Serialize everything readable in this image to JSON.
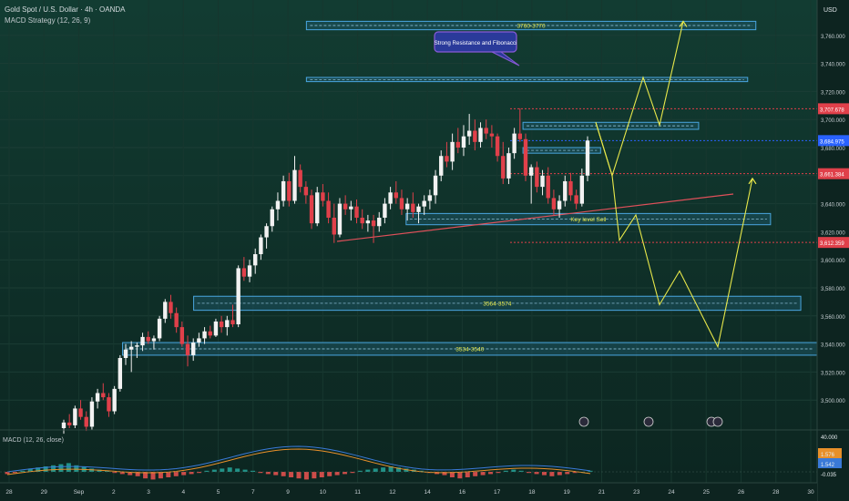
{
  "header": {
    "title": "Gold Spot / U.S. Dollar · 4h · OANDA",
    "indicator": "MACD Strategy (12, 26, 9)",
    "currency": "USD"
  },
  "colors": {
    "bg_top": "#103a30",
    "bg_bottom": "#0d241f",
    "up": "#f2f2f2",
    "down": "#e0404a",
    "zone": "#4aa6e0",
    "zone_fill": "#1f5a6e",
    "projection": "#e8e84a",
    "trendline": "#e0505a",
    "macd_line": "#3a7ad8",
    "signal_line": "#e8902a",
    "hist_pos": "#26a69a",
    "hist_neg": "#ef5350"
  },
  "chart_data": {
    "type": "candlestick",
    "y_range": [
      3480,
      3780
    ],
    "y_ticks": [
      "3,500.000",
      "3,520.000",
      "3,540.000",
      "3,560.000",
      "3,580.000",
      "3,600.000",
      "3,620.000",
      "3,640.000",
      "3,660.000",
      "3,680.000",
      "3,700.000",
      "3,720.000",
      "3,740.000",
      "3,760.000"
    ],
    "x_ticks": [
      "28",
      "29",
      "Sep",
      "2",
      "3",
      "4",
      "5",
      "7",
      "9",
      "10",
      "11",
      "12",
      "14",
      "16",
      "17",
      "18",
      "19",
      "21",
      "23",
      "24",
      "25",
      "26",
      "28",
      "30"
    ],
    "price_labels": [
      {
        "text": "3,707.678",
        "value": 3707.678,
        "color": "#e0404a"
      },
      {
        "text": "3,684.975",
        "value": 3684.975,
        "color": "#2962ff"
      },
      {
        "text": "3,661.384",
        "value": 3661.384,
        "color": "#e0404a"
      },
      {
        "text": "3,612.359",
        "value": 3612.359,
        "color": "#e0404a"
      }
    ],
    "candles": [
      [
        3480,
        3486,
        3476,
        3484
      ],
      [
        3484,
        3490,
        3480,
        3482
      ],
      [
        3482,
        3496,
        3480,
        3494
      ],
      [
        3494,
        3500,
        3486,
        3488
      ],
      [
        3488,
        3492,
        3478,
        3481
      ],
      [
        3481,
        3502,
        3479,
        3499
      ],
      [
        3499,
        3508,
        3494,
        3505
      ],
      [
        3505,
        3512,
        3500,
        3502
      ],
      [
        3502,
        3505,
        3488,
        3492
      ],
      [
        3492,
        3510,
        3490,
        3508
      ],
      [
        3508,
        3532,
        3506,
        3530
      ],
      [
        3530,
        3540,
        3525,
        3536
      ],
      [
        3536,
        3542,
        3520,
        3538
      ],
      [
        3538,
        3541,
        3530,
        3539
      ],
      [
        3539,
        3548,
        3535,
        3545
      ],
      [
        3545,
        3549,
        3540,
        3542
      ],
      [
        3542,
        3546,
        3536,
        3544
      ],
      [
        3544,
        3560,
        3542,
        3558
      ],
      [
        3558,
        3572,
        3555,
        3570
      ],
      [
        3570,
        3575,
        3558,
        3562
      ],
      [
        3562,
        3566,
        3548,
        3552
      ],
      [
        3552,
        3556,
        3538,
        3540
      ],
      [
        3540,
        3546,
        3524,
        3532
      ],
      [
        3532,
        3544,
        3528,
        3541
      ],
      [
        3541,
        3548,
        3538,
        3544
      ],
      [
        3544,
        3552,
        3540,
        3549
      ],
      [
        3549,
        3553,
        3544,
        3546
      ],
      [
        3546,
        3558,
        3545,
        3556
      ],
      [
        3556,
        3560,
        3548,
        3552
      ],
      [
        3552,
        3560,
        3546,
        3557
      ],
      [
        3557,
        3568,
        3552,
        3554
      ],
      [
        3554,
        3596,
        3552,
        3594
      ],
      [
        3594,
        3602,
        3585,
        3588
      ],
      [
        3588,
        3600,
        3584,
        3596
      ],
      [
        3596,
        3608,
        3590,
        3604
      ],
      [
        3604,
        3618,
        3600,
        3616
      ],
      [
        3616,
        3626,
        3608,
        3624
      ],
      [
        3624,
        3638,
        3620,
        3636
      ],
      [
        3636,
        3648,
        3628,
        3642
      ],
      [
        3642,
        3660,
        3638,
        3656
      ],
      [
        3656,
        3662,
        3638,
        3642
      ],
      [
        3642,
        3674,
        3640,
        3664
      ],
      [
        3664,
        3668,
        3648,
        3652
      ],
      [
        3652,
        3656,
        3640,
        3646
      ],
      [
        3646,
        3650,
        3622,
        3626
      ],
      [
        3626,
        3652,
        3624,
        3648
      ],
      [
        3648,
        3654,
        3638,
        3642
      ],
      [
        3642,
        3648,
        3626,
        3630
      ],
      [
        3630,
        3640,
        3612,
        3618
      ],
      [
        3618,
        3644,
        3616,
        3640
      ],
      [
        3640,
        3646,
        3632,
        3636
      ],
      [
        3636,
        3642,
        3628,
        3638
      ],
      [
        3638,
        3643,
        3626,
        3630
      ],
      [
        3630,
        3636,
        3622,
        3626
      ],
      [
        3626,
        3632,
        3620,
        3628
      ],
      [
        3628,
        3632,
        3612,
        3624
      ],
      [
        3624,
        3634,
        3620,
        3630
      ],
      [
        3630,
        3644,
        3626,
        3640
      ],
      [
        3640,
        3652,
        3636,
        3648
      ],
      [
        3648,
        3656,
        3640,
        3644
      ],
      [
        3644,
        3650,
        3632,
        3636
      ],
      [
        3636,
        3644,
        3628,
        3640
      ],
      [
        3640,
        3648,
        3630,
        3634
      ],
      [
        3634,
        3640,
        3626,
        3638
      ],
      [
        3638,
        3646,
        3632,
        3642
      ],
      [
        3642,
        3650,
        3636,
        3646
      ],
      [
        3646,
        3664,
        3640,
        3660
      ],
      [
        3660,
        3678,
        3656,
        3674
      ],
      [
        3674,
        3684,
        3666,
        3670
      ],
      [
        3670,
        3690,
        3664,
        3684
      ],
      [
        3684,
        3694,
        3676,
        3680
      ],
      [
        3680,
        3696,
        3674,
        3688
      ],
      [
        3688,
        3704,
        3682,
        3692
      ],
      [
        3692,
        3700,
        3678,
        3684
      ],
      [
        3684,
        3698,
        3680,
        3694
      ],
      [
        3694,
        3700,
        3686,
        3690
      ],
      [
        3690,
        3696,
        3680,
        3688
      ],
      [
        3688,
        3690,
        3670,
        3674
      ],
      [
        3674,
        3684,
        3654,
        3658
      ],
      [
        3658,
        3680,
        3654,
        3676
      ],
      [
        3676,
        3694,
        3672,
        3690
      ],
      [
        3690,
        3708,
        3684,
        3686
      ],
      [
        3686,
        3690,
        3656,
        3660
      ],
      [
        3660,
        3668,
        3640,
        3666
      ],
      [
        3666,
        3670,
        3648,
        3652
      ],
      [
        3652,
        3664,
        3646,
        3660
      ],
      [
        3660,
        3666,
        3640,
        3644
      ],
      [
        3644,
        3650,
        3632,
        3636
      ],
      [
        3636,
        3646,
        3630,
        3642
      ],
      [
        3642,
        3660,
        3638,
        3656
      ],
      [
        3656,
        3662,
        3642,
        3646
      ],
      [
        3646,
        3650,
        3636,
        3640
      ],
      [
        3640,
        3665,
        3638,
        3660
      ],
      [
        3660,
        3688,
        3656,
        3685
      ]
    ],
    "zones": [
      {
        "label": "3760-3770",
        "top": 3770,
        "bottom": 3764,
        "x0": 0.375,
        "x1": 0.925
      },
      {
        "label": "",
        "top": 3730,
        "bottom": 3727,
        "x0": 0.375,
        "x1": 0.915
      },
      {
        "label": "",
        "top": 3698,
        "bottom": 3693,
        "x0": 0.64,
        "x1": 0.855
      },
      {
        "label": "",
        "top": 3680,
        "bottom": 3676,
        "x0": 0.64,
        "x1": 0.735
      },
      {
        "label": "Key level Sell",
        "top": 3633,
        "bottom": 3625,
        "x0": 0.497,
        "x1": 0.943
      },
      {
        "label": "3564-3574",
        "top": 3574,
        "bottom": 3564,
        "x0": 0.237,
        "x1": 0.98
      },
      {
        "label": "3534-3540",
        "top": 3541,
        "bottom": 3532,
        "x0": 0.15,
        "x1": 1.0
      }
    ],
    "annotation": {
      "text": "Strong Resistance and Fibonacci"
    },
    "macd": {
      "label": "MACD (12, 26, close)",
      "ticks": [
        "40.000",
        "1.576",
        "1.542",
        "-0.035"
      ],
      "hist": [
        -2,
        -1,
        1,
        3,
        4,
        5,
        6,
        7,
        8,
        6,
        5,
        3,
        2,
        1,
        -1,
        -2,
        -3,
        -4,
        -6,
        -7,
        -6,
        -5,
        -4,
        -3,
        -2,
        -1,
        1,
        2,
        3,
        4,
        3,
        2,
        1,
        -1,
        -2,
        -3,
        -4,
        -5,
        -6,
        -7,
        -6,
        -5,
        -4,
        -3,
        -2,
        -1,
        1,
        2,
        3,
        4,
        5,
        4,
        3,
        2,
        1,
        -1,
        -2,
        -3,
        -5,
        -6,
        -5,
        -4,
        -3,
        -2,
        -1,
        1,
        2,
        1,
        -1,
        -2,
        -3,
        -4,
        -3,
        -2,
        -1,
        0,
        1
      ]
    }
  }
}
